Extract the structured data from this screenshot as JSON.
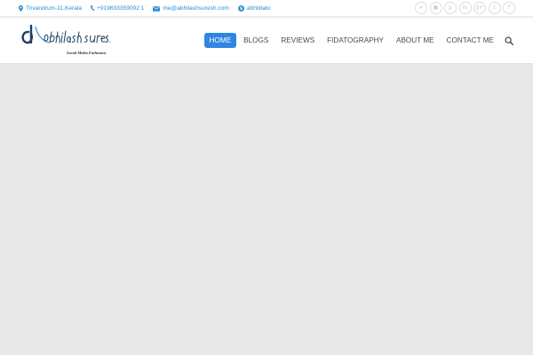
{
  "topbar": {
    "location": "Trivandrum-11,Kerala",
    "phone": "+919633359092 1",
    "email": "me@abhilashsuresh.com",
    "skype": "abhildato"
  },
  "socials": [
    {
      "name": "link-icon",
      "glyph": "∞"
    },
    {
      "name": "instagram-icon",
      "glyph": "▣"
    },
    {
      "name": "pinterest-icon",
      "glyph": "p"
    },
    {
      "name": "linkedin-icon",
      "glyph": "in"
    },
    {
      "name": "google-plus-icon",
      "glyph": "g+"
    },
    {
      "name": "twitter-icon",
      "glyph": "t"
    },
    {
      "name": "facebook-icon",
      "glyph": "f"
    }
  ],
  "logo": {
    "text": "abhilash suresh",
    "tagline": "Social Media Enthusiast"
  },
  "nav": {
    "items": [
      {
        "label": "HOME",
        "active": true
      },
      {
        "label": "BLOGS",
        "active": false
      },
      {
        "label": "REVIEWS",
        "active": false
      },
      {
        "label": "FIDATOGRAPHY",
        "active": false
      },
      {
        "label": "ABOUT ME",
        "active": false
      },
      {
        "label": "CONTACT ME",
        "active": false
      }
    ]
  },
  "colors": {
    "accent": "#2f86e0",
    "contact_text": "#2a8fd4",
    "content_bg": "#e8e8e8"
  }
}
